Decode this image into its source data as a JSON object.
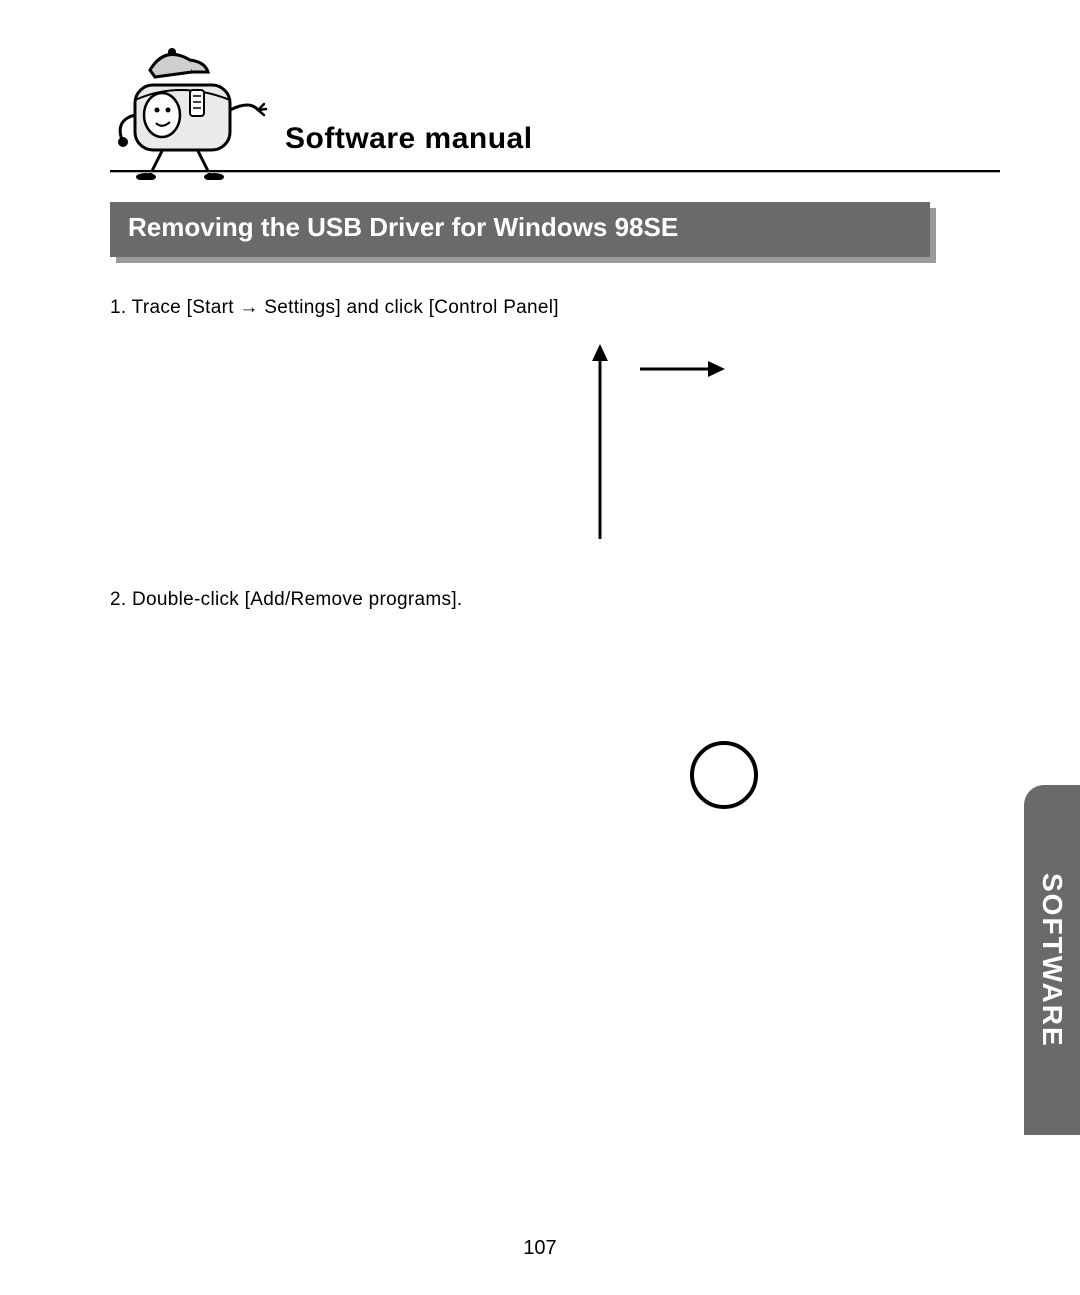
{
  "header": {
    "title": "Software manual"
  },
  "section": {
    "title": "Removing the USB Driver for Windows 98SE"
  },
  "steps": {
    "one": "1. Trace [Start → Settings] and click [Control Panel]",
    "two": "2. Double-click [Add/Remove programs]."
  },
  "sideTab": "SOFTWARE",
  "pageNumber": "107"
}
